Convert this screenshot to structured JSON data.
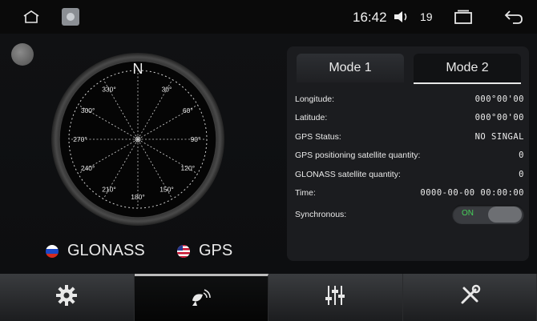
{
  "status_bar": {
    "time": "16:42",
    "volume": "19",
    "icons": [
      "home-icon",
      "app-icon",
      "volume-icon",
      "recent-apps-icon",
      "back-icon"
    ]
  },
  "compass": {
    "north_label": "N",
    "bearings": [
      "30°",
      "60°",
      "90°",
      "120°",
      "150°",
      "180°",
      "210°",
      "240°",
      "270°",
      "300°",
      "330°"
    ]
  },
  "legend": {
    "glonass_label": "GLONASS",
    "gps_label": "GPS"
  },
  "tabs": [
    {
      "label": "Mode 1"
    },
    {
      "label": "Mode 2"
    }
  ],
  "info_rows": [
    {
      "label": "Longitude:",
      "value": "000°00'00"
    },
    {
      "label": "Latitude:",
      "value": "000°00'00"
    },
    {
      "label": "GPS Status:",
      "value": "NO SINGAL"
    },
    {
      "label": "GPS positioning satellite quantity:",
      "value": "0"
    },
    {
      "label": "GLONASS satellite quantity:",
      "value": "0"
    },
    {
      "label": "Time:",
      "value": "0000-00-00 00:00:00"
    }
  ],
  "synchronous": {
    "label": "Synchronous:",
    "state": "ON"
  },
  "nav": [
    "settings-icon",
    "satellite-dish-icon",
    "equalizer-icon",
    "tools-icon"
  ],
  "colors": {
    "toggle_on": "#47d05a",
    "panel_bg": "#1b1c1f"
  }
}
